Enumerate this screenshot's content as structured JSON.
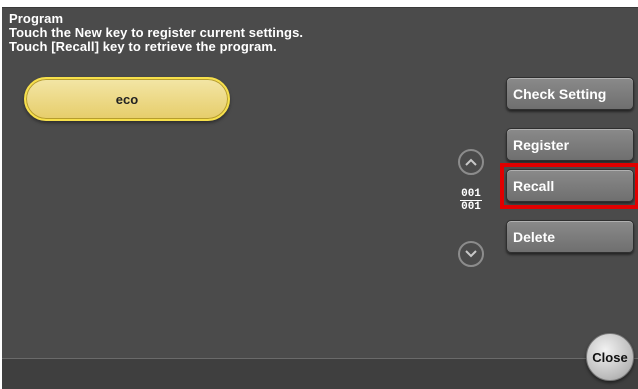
{
  "header": {
    "title": "Program",
    "line1": "Touch the New key to register current settings.",
    "line2": "Touch [Recall] key to retrieve the program."
  },
  "programs": [
    {
      "label": "eco",
      "selected": true
    }
  ],
  "buttons": {
    "check_setting": "Check Setting",
    "register": "Register",
    "recall": "Recall",
    "delete": "Delete",
    "close": "Close"
  },
  "pagination": {
    "current": "001",
    "total": "001"
  },
  "icons": {
    "scroll_up": "chevron-up-icon",
    "scroll_down": "chevron-down-icon"
  },
  "colors": {
    "highlight": "#e00000",
    "program_pill": "#e6cd6a",
    "panel_bg": "#4b4b4b"
  }
}
